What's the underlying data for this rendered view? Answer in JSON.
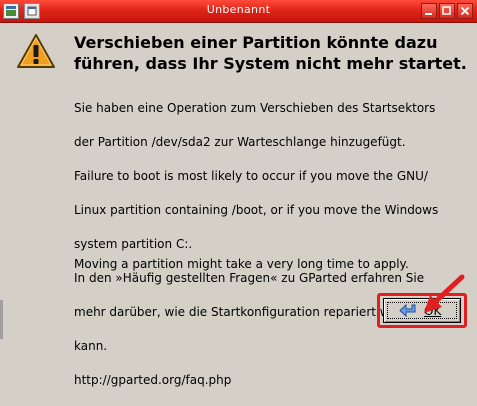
{
  "window": {
    "title": "Unbenannt"
  },
  "icons": {
    "app": "app-window-icon",
    "menu": "window-menu-icon",
    "minimize": "minimize-icon",
    "maximize": "maximize-icon",
    "close": "close-icon",
    "warning": "warning-icon",
    "ok": "ok-arrow-icon"
  },
  "dialog": {
    "heading": "Verschieben einer Partition könnte dazu führen, dass Ihr System nicht mehr startet.",
    "message_lines": [
      "Sie haben eine Operation zum Verschieben des Startsektors",
      "der Partition /dev/sda2 zur Warteschlange hinzugefügt.",
      "Failure to boot is most likely to occur if you move the GNU/",
      "Linux partition containing /boot, or if you move the Windows",
      "system partition C:.",
      "In den »Häufig gestellten Fragen« zu GParted erfahren Sie",
      "mehr darüber, wie die Startkonfiguration repariert werden",
      "kann.",
      "http://gparted.org/faq.php"
    ],
    "apply_note": "Moving a partition might take a very long time to apply.",
    "ok_label": "OK"
  },
  "colors": {
    "titlebar": "#e0251a",
    "highlight": "#e02020",
    "warning_fill": "#f0a020"
  }
}
